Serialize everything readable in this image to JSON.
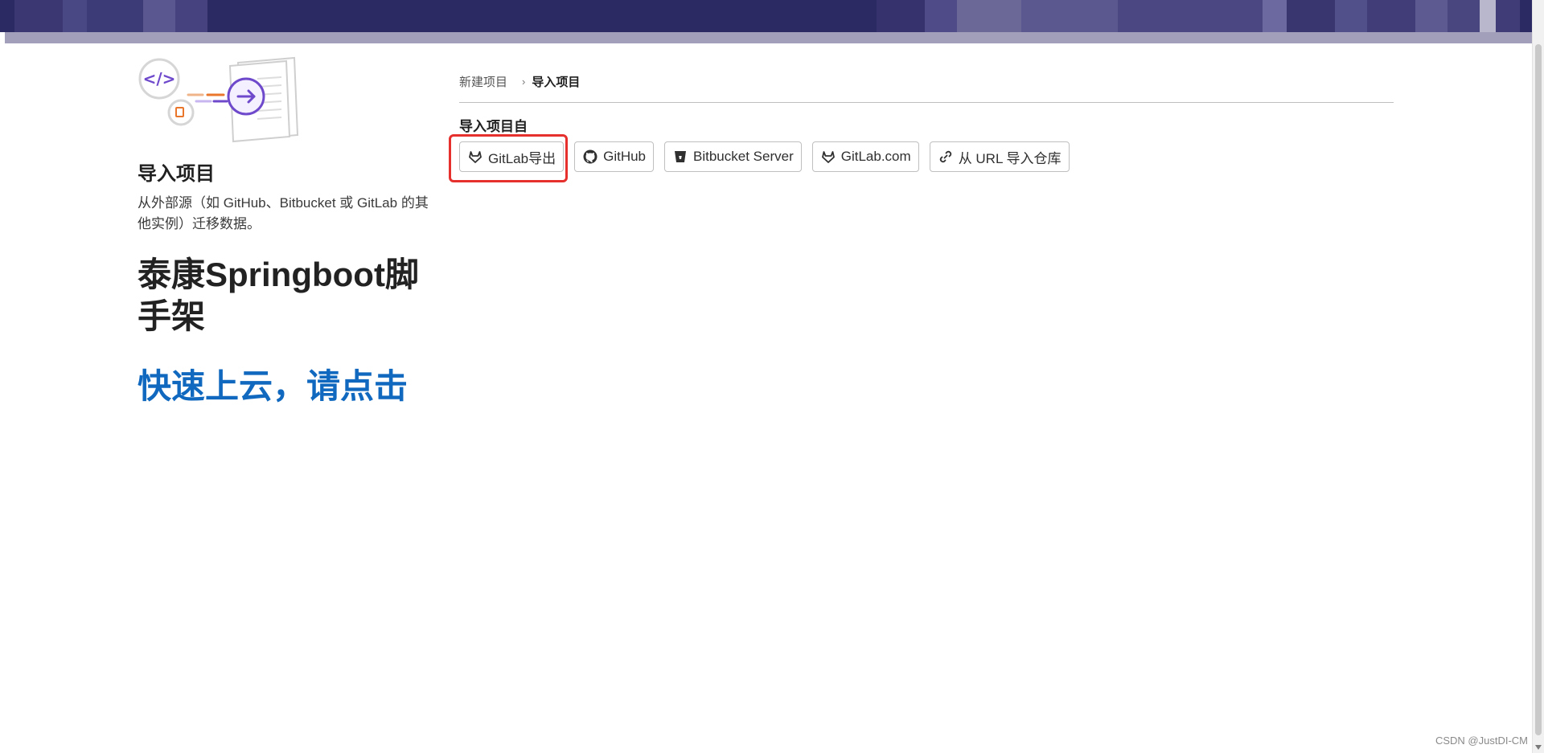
{
  "left": {
    "title": "导入项目",
    "description": "从外部源（如 GitHub、Bitbucket 或 GitLab 的其他实例）迁移数据。",
    "promo_title": "泰康Springboot脚手架",
    "promo_link": "快速上云，请点击"
  },
  "breadcrumb": {
    "items": [
      {
        "label": "新建项目"
      },
      {
        "label": "导入项目"
      }
    ],
    "separator": "›"
  },
  "import": {
    "section_label": "导入项目自",
    "buttons": [
      {
        "label": "GitLab导出",
        "icon": "gitlab-icon"
      },
      {
        "label": "GitHub",
        "icon": "github-icon"
      },
      {
        "label": "Bitbucket Server",
        "icon": "bitbucket-icon"
      },
      {
        "label": "GitLab.com",
        "icon": "gitlab-icon"
      },
      {
        "label": "从 URL 导入仓库",
        "icon": "link-icon"
      }
    ]
  },
  "watermark": "CSDN @JustDI-CM",
  "colors": {
    "banner": "#2c2a63",
    "banner_strip": "#a29fba",
    "link_blue": "#1068bf",
    "highlight_red": "#e5302d",
    "illustration_purple": "#6e49cb",
    "illustration_orange": "#e9762b"
  }
}
